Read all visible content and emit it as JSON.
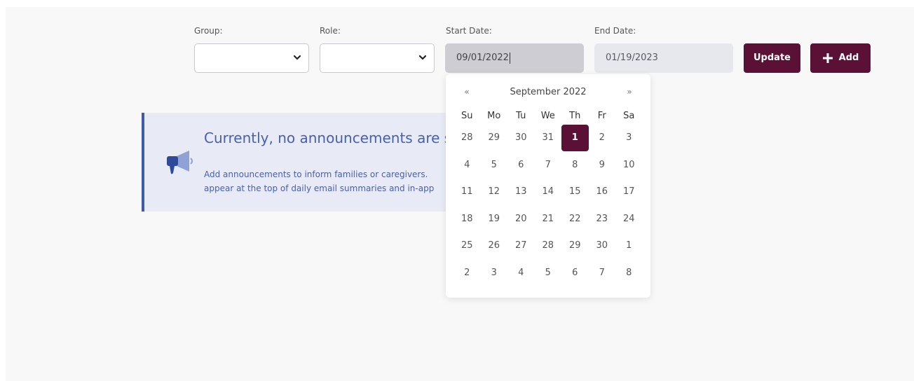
{
  "filters": {
    "group": {
      "label": "Group:",
      "value": ""
    },
    "role": {
      "label": "Role:",
      "value": ""
    },
    "start_date": {
      "label": "Start Date:",
      "value": "09/01/2022"
    },
    "end_date": {
      "label": "End Date:",
      "value": "01/19/2023"
    }
  },
  "buttons": {
    "update_label": "Update",
    "add_label": "Add",
    "accent_color": "#5b1035"
  },
  "banner": {
    "title": "Currently, no announcements are s",
    "text_line1": "Add announcements to inform families or caregivers.",
    "text_line2": "appear at the top of daily email summaries and in-app",
    "icon": "megaphone-icon",
    "accent_color": "#3e5bab"
  },
  "calendar": {
    "prev": "«",
    "next": "»",
    "month_title": "September 2022",
    "weekdays": [
      "Su",
      "Mo",
      "Tu",
      "We",
      "Th",
      "Fr",
      "Sa"
    ],
    "weeks": [
      [
        "28",
        "29",
        "30",
        "31",
        "1",
        "2",
        "3"
      ],
      [
        "4",
        "5",
        "6",
        "7",
        "8",
        "9",
        "10"
      ],
      [
        "11",
        "12",
        "13",
        "14",
        "15",
        "16",
        "17"
      ],
      [
        "18",
        "19",
        "20",
        "21",
        "22",
        "23",
        "24"
      ],
      [
        "25",
        "26",
        "27",
        "28",
        "29",
        "30",
        "1"
      ],
      [
        "2",
        "3",
        "4",
        "5",
        "6",
        "7",
        "8"
      ]
    ],
    "selected_day": "1"
  }
}
